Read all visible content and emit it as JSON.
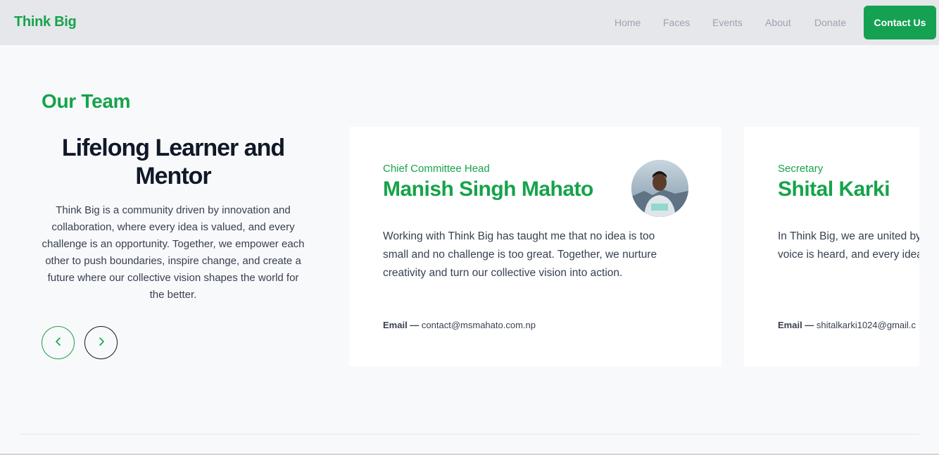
{
  "header": {
    "brand": "Think Big",
    "nav": [
      "Home",
      "Faces",
      "Events",
      "About",
      "Donate"
    ],
    "cta": "Contact Us"
  },
  "section": {
    "label": "Our Team",
    "title": "Lifelong Learner and Mentor",
    "description": "Think Big is a community driven by innovation and collaboration, where every idea is valued, and every challenge is an opportunity. Together, we empower each other to push boundaries, inspire change, and create a future where our collective vision shapes the world for the better."
  },
  "controls": {
    "prev_icon": "chevron-left-icon",
    "next_icon": "chevron-right-icon"
  },
  "cards": [
    {
      "role": "Chief Committee Head",
      "name": "Manish Singh Mahato",
      "quote": "Working with Think Big has taught me that no idea is too small and no challenge is too great. Together, we nurture creativity and turn our collective vision into action.",
      "email_label": "Email —",
      "email": "contact@msmahato.com.np"
    },
    {
      "role": "Secretary",
      "name": "Shital Karki",
      "quote": "In Think Big, we are united by beyond limits and make a dif voice is heard, and every idea the world.",
      "email_label": "Email —",
      "email": "shitalkarki1024@gmail.c"
    }
  ],
  "colors": {
    "accent": "#16a34a",
    "header_bg": "#e5e7eb",
    "page_bg": "#f8f9fb"
  }
}
